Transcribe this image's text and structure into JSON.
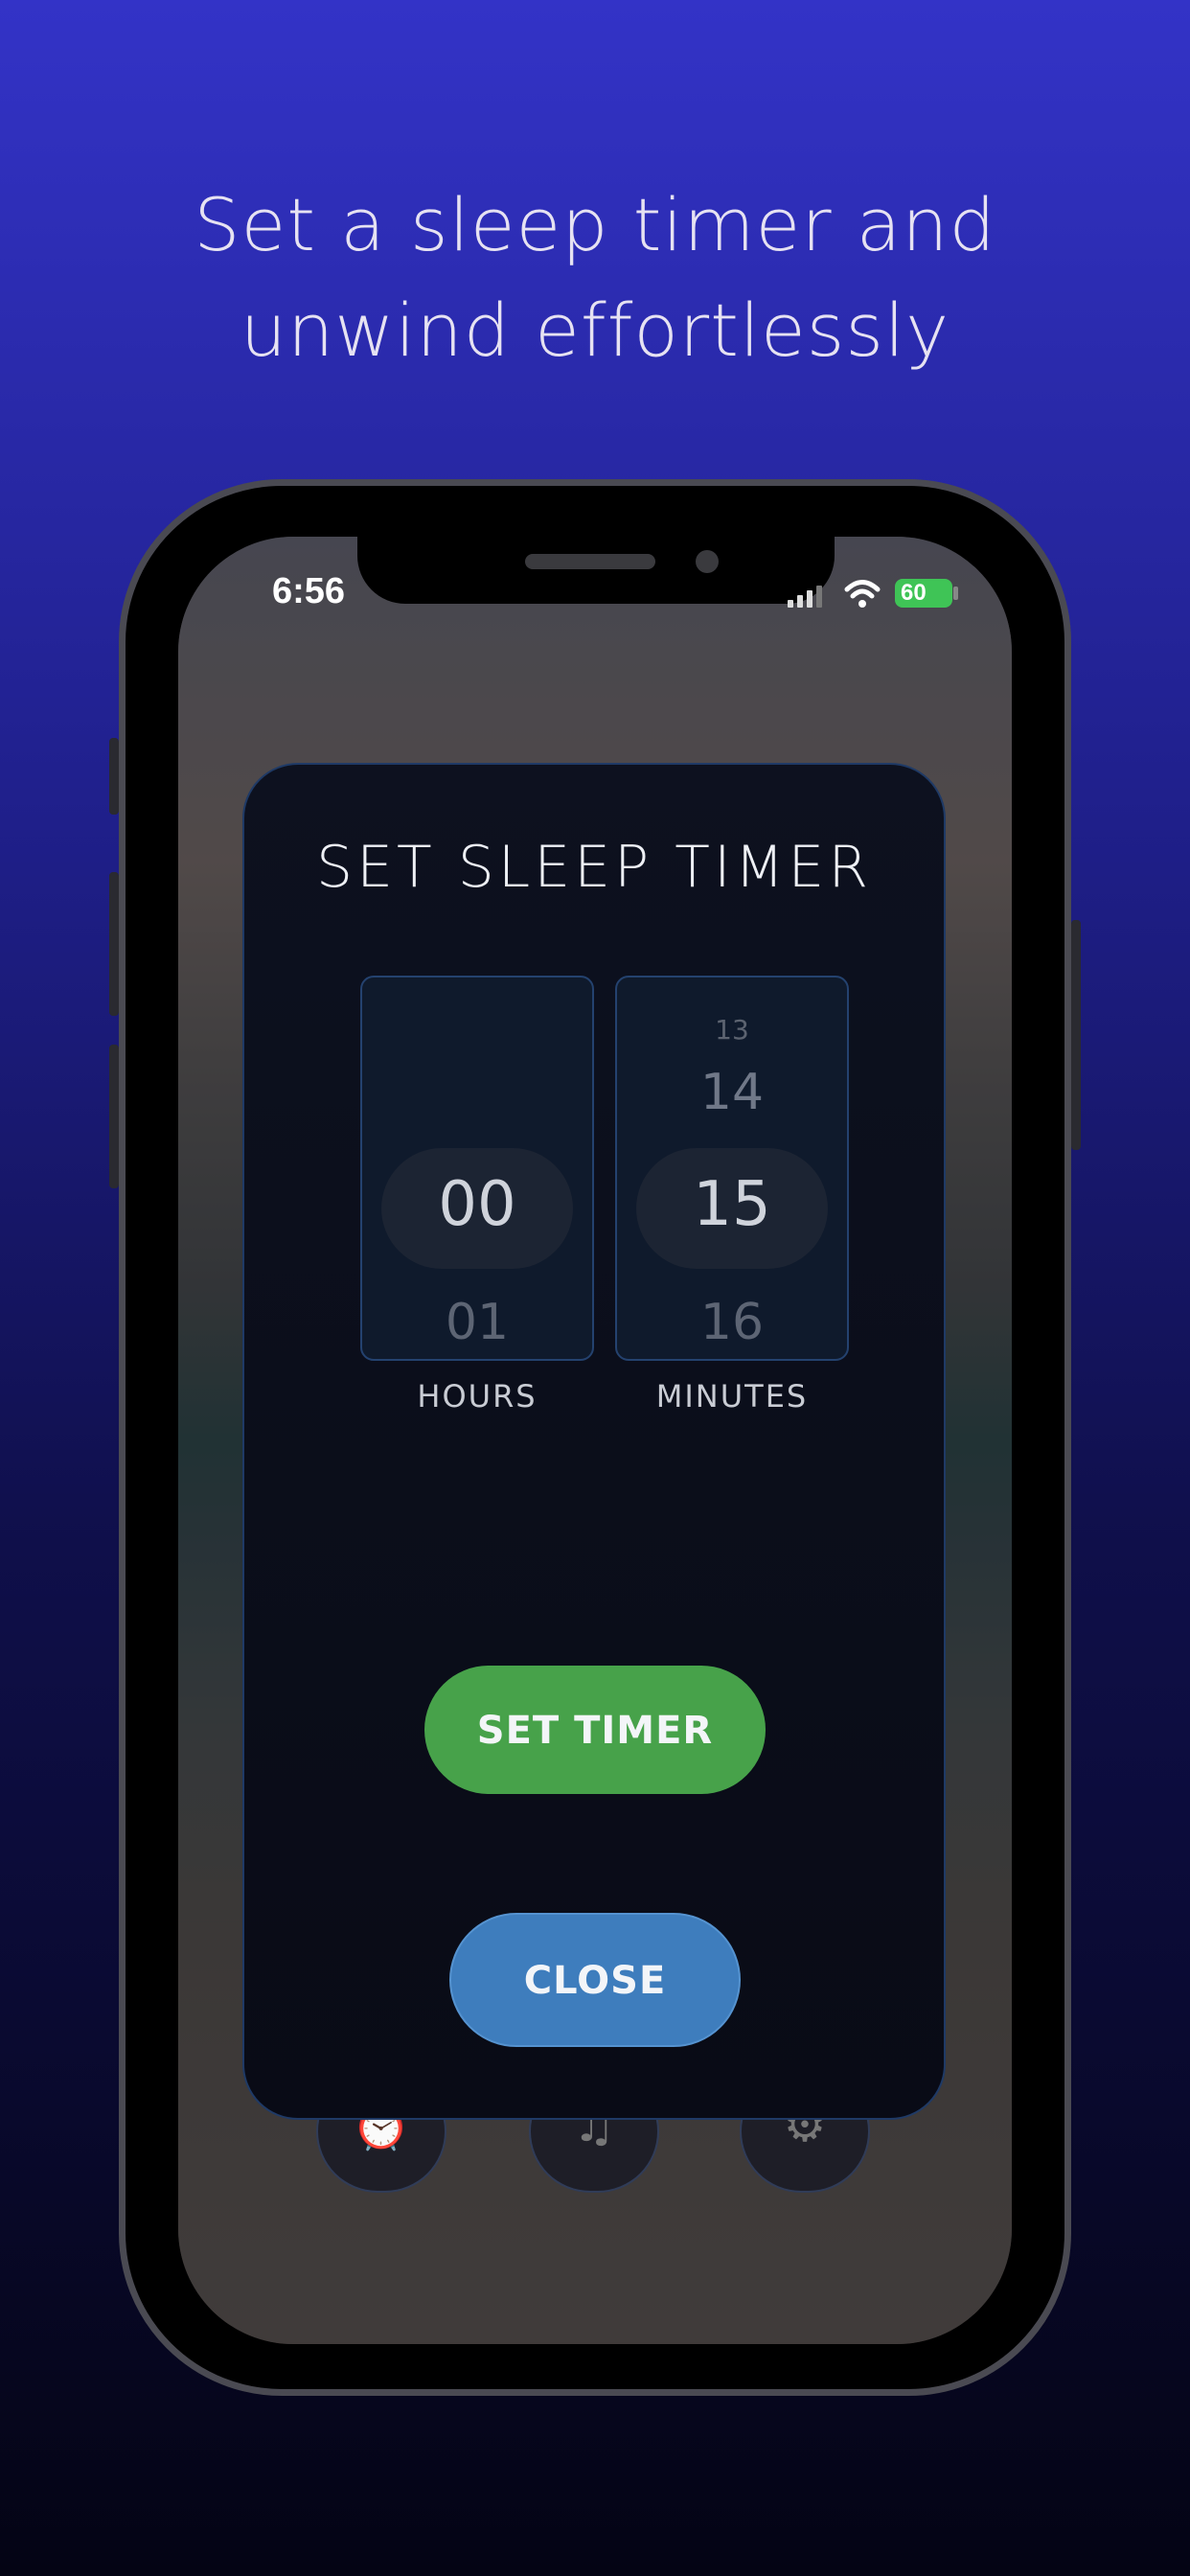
{
  "headline": {
    "line1": "Set a sleep timer and",
    "line2": "unwind effortlessly"
  },
  "status_bar": {
    "time": "6:56",
    "battery": "60"
  },
  "modal": {
    "title": "SET SLEEP TIMER",
    "hours": {
      "label": "HOURS",
      "selected": "00",
      "next": "01"
    },
    "minutes": {
      "label": "MINUTES",
      "prev2": "13",
      "prev": "14",
      "selected": "15",
      "next": "16"
    },
    "set_button": "SET TIMER",
    "close_button": "CLOSE"
  },
  "background_nav": [
    {
      "icon": "alarm-clock-icon"
    },
    {
      "icon": "music-note-icon"
    },
    {
      "icon": "gear-icon"
    }
  ],
  "colors": {
    "set_button": "#47a24a",
    "close_button": "#3e7dbd",
    "battery": "#3fc456"
  }
}
